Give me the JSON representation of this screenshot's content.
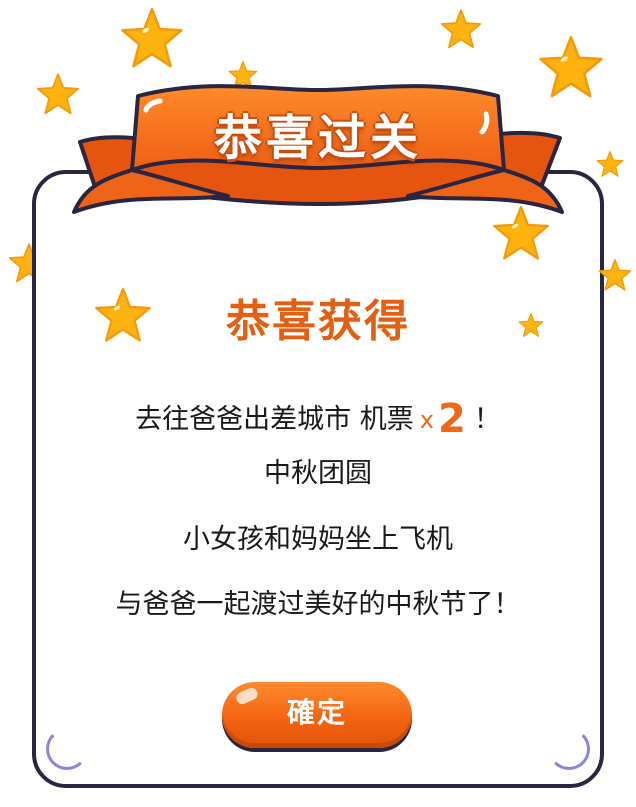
{
  "banner": {
    "title": "恭喜过关"
  },
  "dialog": {
    "heading": "恭喜获得",
    "prize_line_text": "去往爸爸出差城市 机票",
    "prize_times": "x",
    "prize_count": "2",
    "prize_exclaim": "！",
    "line2": "中秋团圆",
    "line3": "小女孩和妈妈坐上飞机",
    "line4": "与爸爸一起渡过美好的中秋节了！"
  },
  "buttons": {
    "confirm_label": "確定"
  },
  "colors": {
    "accent": "#ef6a14",
    "star": "#ffb30f",
    "ribbon": "#f36a1a",
    "outline": "#2a2540"
  },
  "icons": [
    "star-icon"
  ]
}
